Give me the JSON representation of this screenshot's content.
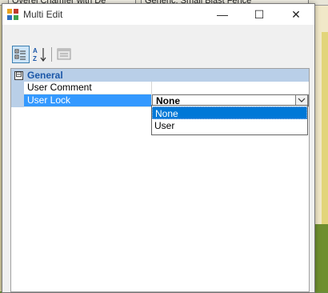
{
  "background": {
    "tabs": [
      "Overel Chamfer with De",
      "Generic: Small Blast Fence"
    ]
  },
  "window": {
    "title": "Multi Edit",
    "min_glyph": "—",
    "max_glyph": "☐",
    "close_glyph": "✕"
  },
  "toolbar": {
    "buttons": [
      {
        "name": "categorized-icon",
        "active": true
      },
      {
        "name": "alphabetical-sort-icon",
        "active": false
      },
      {
        "name": "property-pages-icon",
        "active": false
      }
    ]
  },
  "property_grid": {
    "category": {
      "toggle": "⊟",
      "label": "General"
    },
    "rows": [
      {
        "name": "User Comment",
        "value": ""
      },
      {
        "name": "User Lock",
        "value": "None"
      }
    ]
  },
  "dropdown": {
    "options": [
      "None",
      "User"
    ],
    "selected": "None"
  },
  "colors": {
    "selection": "#0078d7",
    "category_band": "#b9cfe8",
    "category_text": "#1b57a8",
    "row_highlight": "#3399ff"
  }
}
